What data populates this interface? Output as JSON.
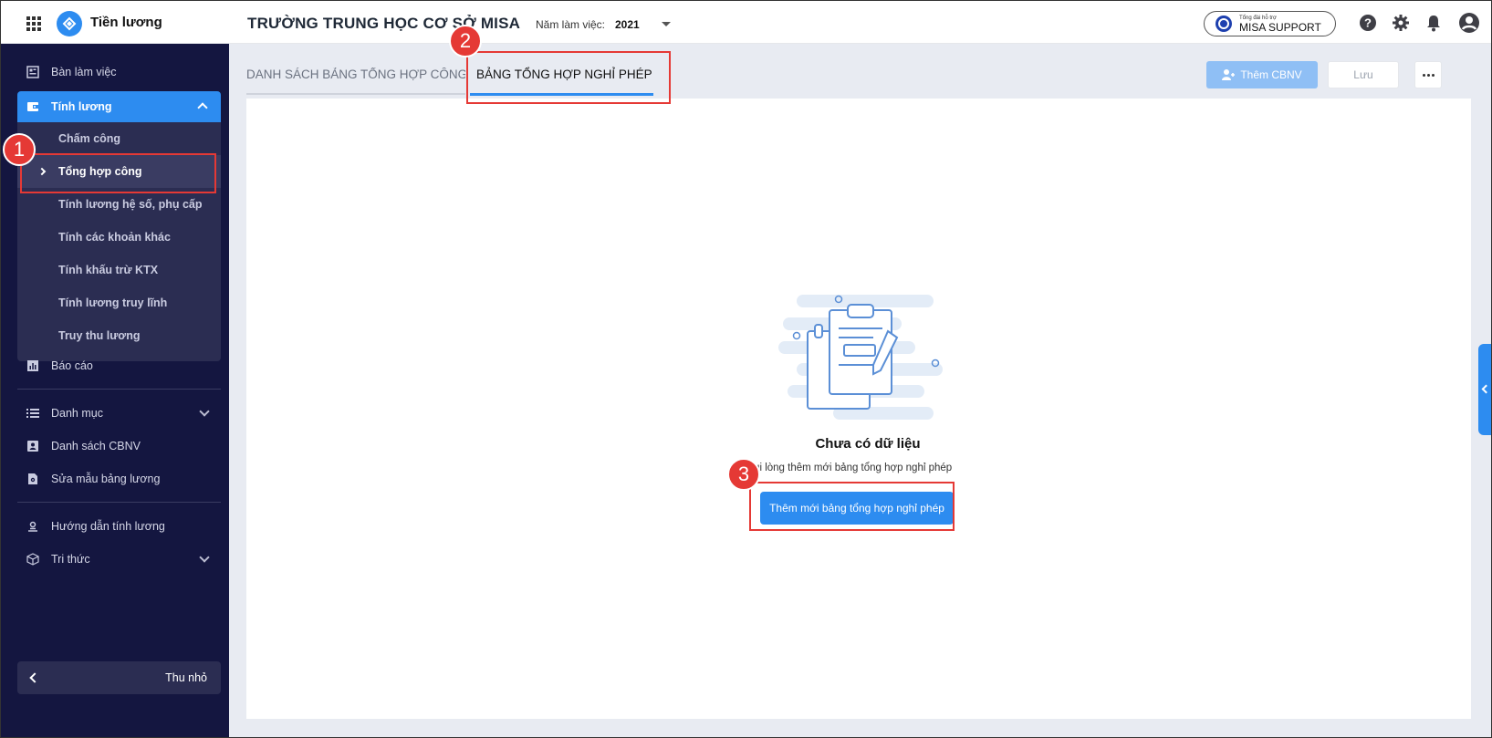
{
  "header": {
    "app_name": "Tiền lương",
    "school_name": "TRƯỜNG TRUNG HỌC CƠ SỞ MISA",
    "year_label": "Năm làm việc:",
    "year_value": "2021",
    "support_small": "Tổng đài hỗ trợ",
    "support_big": "MISA SUPPORT"
  },
  "sidebar": {
    "items": [
      {
        "label": "Bàn làm việc",
        "icon": "dashboard-icon"
      },
      {
        "label": "Tính lương",
        "icon": "wallet-icon"
      },
      {
        "label": "Báo cáo",
        "icon": "report-icon"
      },
      {
        "label": "Danh mục",
        "icon": "list-icon"
      },
      {
        "label": "Danh sách CBNV",
        "icon": "person-card-icon"
      },
      {
        "label": "Sửa mẫu bảng lương",
        "icon": "doc-settings-icon"
      },
      {
        "label": "Hướng dẫn tính lương",
        "icon": "guide-icon"
      },
      {
        "label": "Tri thức",
        "icon": "cube-icon"
      }
    ],
    "submenu": [
      "Chấm công",
      "Tổng hợp công",
      "Tính lương hệ số, phụ cấp",
      "Tính các khoản khác",
      "Tính khấu trừ KTX",
      "Tính lương truy lĩnh",
      "Truy thu lương"
    ],
    "collapse_label": "Thu nhỏ"
  },
  "tabs": {
    "tab1": "DANH SÁCH BẢNG TỔNG HỢP CÔNG",
    "tab2": "BẢNG TỔNG HỢP NGHỈ PHÉP"
  },
  "toolbar": {
    "add_label": "Thêm CBNV",
    "save_label": "Lưu"
  },
  "empty_state": {
    "title": "Chưa có dữ liệu",
    "hint": "Vui lòng thêm mới bảng tổng hợp nghỉ phép",
    "button_label": "Thêm mới bảng tổng hợp nghỉ phép"
  },
  "annotations": [
    "1",
    "2",
    "3"
  ],
  "colors": {
    "sidebar_bg": "#141640",
    "accent": "#2d8cf0",
    "highlight": "#e53935"
  }
}
